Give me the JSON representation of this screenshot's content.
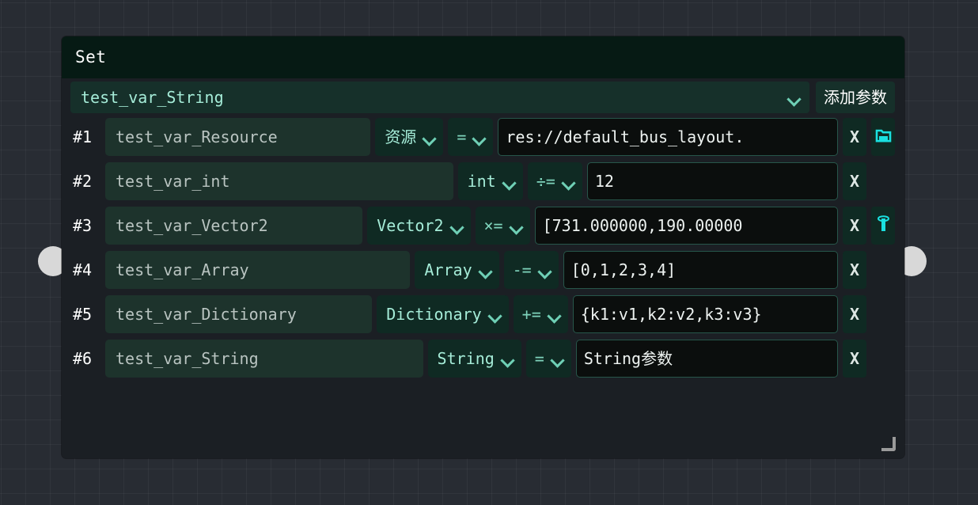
{
  "node": {
    "title": "Set",
    "variable_select": {
      "value": "test_var_String",
      "chevron_icon": "chevron-down-icon"
    },
    "add_param_button": "添加参数",
    "resize_handle_icon": "resize-grip-icon",
    "ports": {
      "left_icon": "input-port-circle",
      "right_icon": "output-port-circle"
    }
  },
  "params": [
    {
      "index": "#1",
      "name": "test_var_Resource",
      "type": "资源",
      "operator": "=",
      "value": "res://default_bus_layout.",
      "remove_label": "X",
      "extra_icon": "folder-open-icon"
    },
    {
      "index": "#2",
      "name": "test_var_int",
      "type": "int",
      "operator": "÷=",
      "value": "12",
      "remove_label": "X",
      "extra_icon": null
    },
    {
      "index": "#3",
      "name": "test_var_Vector2",
      "type": "Vector2",
      "operator": "×=",
      "value": "[731.000000,190.00000",
      "remove_label": "X",
      "extra_icon": "position-pin-icon"
    },
    {
      "index": "#4",
      "name": "test_var_Array",
      "type": "Array",
      "operator": "-=",
      "value": "[0,1,2,3,4]",
      "remove_label": "X",
      "extra_icon": null
    },
    {
      "index": "#5",
      "name": "test_var_Dictionary",
      "type": "Dictionary",
      "operator": "+=",
      "value": "{k1:v1,k2:v2,k3:v3}",
      "remove_label": "X",
      "extra_icon": null
    },
    {
      "index": "#6",
      "name": "test_var_String",
      "type": "String",
      "operator": "=",
      "value": "String参数",
      "remove_label": "X",
      "extra_icon": null
    }
  ],
  "colors": {
    "canvas_bg": "#282c33",
    "node_bg": "#1b1f24",
    "titlebar_bg": "#061a14",
    "field_bg": "#1d332c",
    "value_bg": "#0b0e0d",
    "accent_mint": "#a5ecd8",
    "accent_cyan": "#1ae0e0",
    "port": "#d8d8d8"
  }
}
